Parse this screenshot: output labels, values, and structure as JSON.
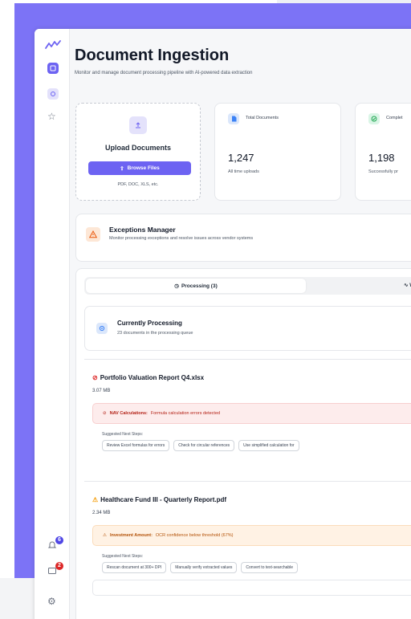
{
  "app": {
    "title": "Document Ingestion",
    "subtitle": "Monitor and manage document processing pipeline with AI-powered data extraction"
  },
  "sidebar": {
    "notification_count": "6",
    "alert_count": "2"
  },
  "upload": {
    "title": "Upload Documents",
    "button_label": "Browse Files",
    "hint": "PDF, DOC, XLS, etc."
  },
  "stats": [
    {
      "label": "Total Documents",
      "value": "1,247",
      "sub": "All time uploads",
      "icon": "document-icon",
      "color": "#dbe7fb"
    },
    {
      "label": "Complet",
      "value": "1,198",
      "sub": "Successfully pr",
      "icon": "check-icon",
      "color": "#daf5e6"
    }
  ],
  "exceptions": {
    "title": "Exceptions Manager",
    "subtitle": "Monitor processing exceptions and resolve issues across vendor systems"
  },
  "tabs": {
    "processing": "Processing (3)",
    "second": "W"
  },
  "currently": {
    "title": "Currently Processing",
    "subtitle": "23 documents in the processing queue"
  },
  "items": [
    {
      "title": "Portfolio Valuation Report Q4.xlsx",
      "size": "3.07 MB",
      "alert_label": "NAV Calculations:",
      "alert_text": "Formula calculation errors detected",
      "next_label": "Suggested Next Steps:",
      "steps": [
        "Review Excel formulas for errors",
        "Check for circular references",
        "Use simplified calculation for"
      ]
    },
    {
      "title": "Healthcare Fund III - Quarterly Report.pdf",
      "size": "2.34 MB",
      "alert_label": "Investment Amount:",
      "alert_text": "OCR confidence below threshold (67%)",
      "next_label": "Suggested Next Steps:",
      "steps": [
        "Rescan document at 300+ DPI",
        "Manually verify extracted values",
        "Convert to text-searchable"
      ]
    }
  ],
  "colors": {
    "accent": "#6d63f2",
    "background": "#7c73f6",
    "error": "#dc2626",
    "warning": "#f59e0b"
  }
}
